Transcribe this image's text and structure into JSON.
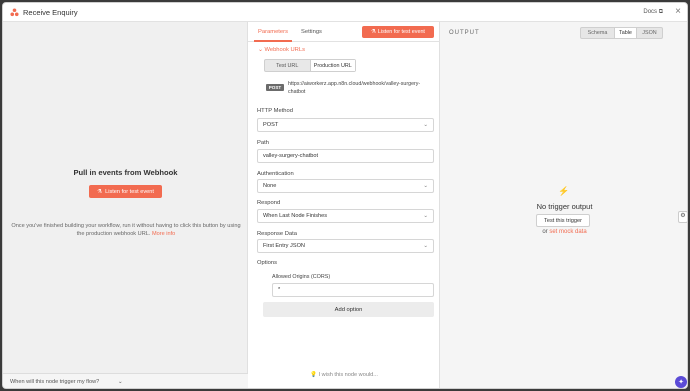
{
  "window": {
    "title": "Receive Enquiry",
    "docs_label": "Docs ⧉",
    "close_glyph": "×"
  },
  "left_panel": {
    "heading": "Pull in events from Webhook",
    "listen_button": "Listen for test event",
    "description": "Once you've finished building your workflow, run it without having to click this button by using the production webhook URL.",
    "more_info": "More info",
    "footer_text": "When will this node trigger my flow?"
  },
  "params": {
    "tabs": [
      "Parameters",
      "Settings"
    ],
    "listen_button": "Listen for test event",
    "webhook_urls_label": "Webhook URLs",
    "url_toggle": [
      "Test URL",
      "Production URL"
    ],
    "method_badge": "POST",
    "url": "https://aiworkerz.app.n8n.cloud/webhook/valley-surgery-chatbot",
    "http_method_label": "HTTP Method",
    "http_method_value": "POST",
    "path_label": "Path",
    "path_value": "valley-surgery-chatbot",
    "authentication_label": "Authentication",
    "authentication_value": "None",
    "respond_label": "Respond",
    "respond_value": "When Last Node Finishes",
    "response_data_label": "Response Data",
    "response_data_value": "First Entry JSON",
    "options_label": "Options",
    "allowed_origins_label": "Allowed Origins (CORS)",
    "allowed_origins_value": "*",
    "add_option": "Add option",
    "wish": "I wish this node would..."
  },
  "output": {
    "heading": "OUTPUT",
    "views": [
      "Schema",
      "Table",
      "JSON"
    ],
    "selected_view": "Table",
    "empty_title": "No trigger output",
    "test_button": "Test this trigger",
    "or_text": "or",
    "mock_link": "set mock data"
  },
  "colors": {
    "accent": "#f26b50",
    "assistant": "#5b4bd6"
  },
  "icons": [
    "n8n-logo-icon",
    "external-link-icon",
    "close-icon",
    "flask-icon",
    "chevron-down-icon",
    "lightning-bolt-icon",
    "lightbulb-icon",
    "robot-icon",
    "sparkle-icon"
  ]
}
